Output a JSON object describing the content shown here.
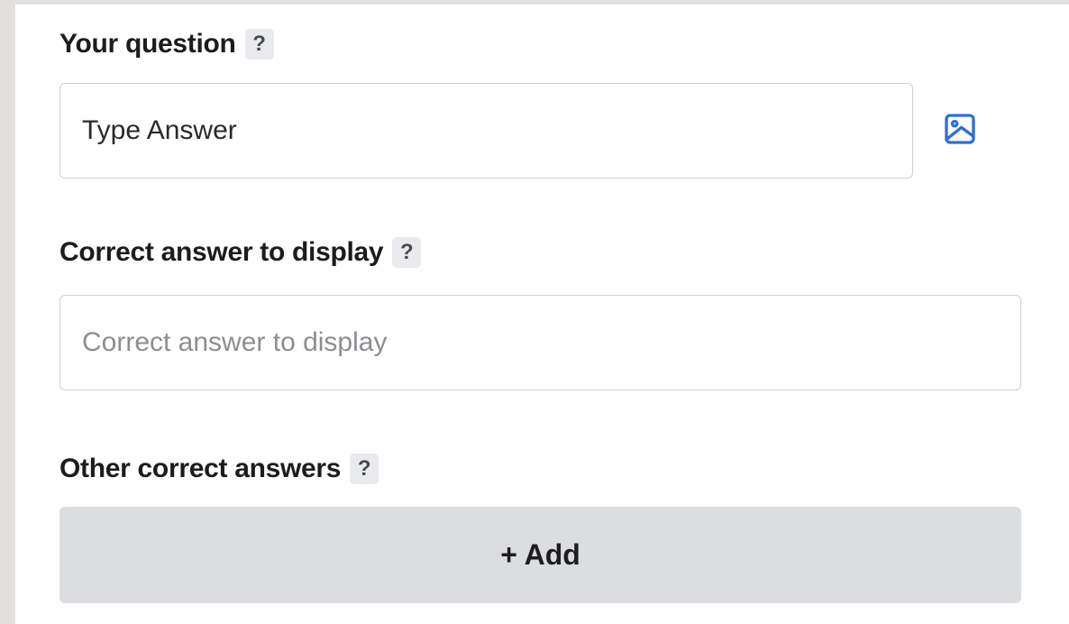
{
  "question_section": {
    "label": "Your question",
    "help": "?",
    "input_value": "Type Answer",
    "image_icon": "image-icon"
  },
  "correct_answer_section": {
    "label": "Correct answer to display",
    "help": "?",
    "input_value": "",
    "placeholder": "Correct answer to display"
  },
  "other_answers_section": {
    "label": "Other correct answers",
    "help": "?",
    "add_label": "+ Add"
  },
  "colors": {
    "accent": "#2f6fd6",
    "button_bg": "#dcdde1",
    "badge_bg": "#e9eaee",
    "border": "#cfd0d4"
  }
}
